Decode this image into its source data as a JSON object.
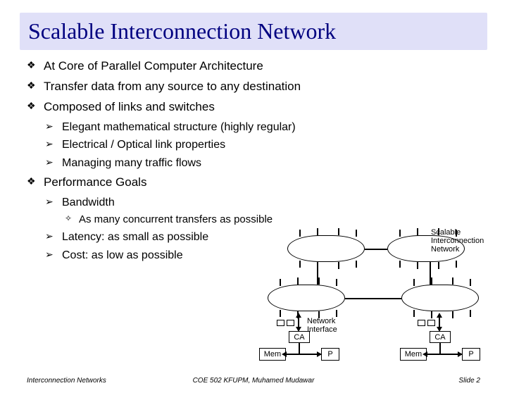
{
  "title": "Scalable Interconnection Network",
  "bullets": {
    "b1": "At Core of Parallel Computer Architecture",
    "b2": "Transfer data from any source to any destination",
    "b3": "Composed of links and switches",
    "b3a": "Elegant mathematical structure (highly regular)",
    "b3b": "Electrical / Optical link properties",
    "b3c": "Managing many traffic flows",
    "b4": "Performance Goals",
    "b4a": "Bandwidth",
    "b4a1": "As many concurrent transfers as possible",
    "b4b": "Latency: as small as possible",
    "b4c": "Cost: as low as possible"
  },
  "diagram": {
    "net_label": "Scalable Interconnection Network",
    "ni_label": "Network Interface",
    "ca": "CA",
    "mem": "Mem",
    "p": "P"
  },
  "footer": {
    "left": "Interconnection Networks",
    "center": "COE 502 KFUPM, Muhamed Mudawar",
    "right": "Slide 2"
  }
}
